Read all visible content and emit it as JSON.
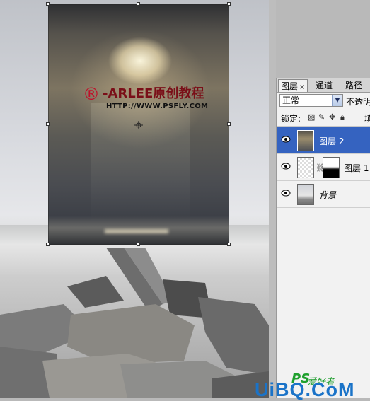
{
  "watermark": {
    "mark": "®",
    "title": "-ARLEE原创教程",
    "url": "HTTP://WWW.PSFLY.COM"
  },
  "layers_panel": {
    "tabs": [
      {
        "label": "图层",
        "close": "×",
        "active": true
      },
      {
        "label": "通道",
        "active": false
      },
      {
        "label": "路径",
        "active": false
      }
    ],
    "blend_mode": "正常",
    "opacity_label": "不透明",
    "lock_label": "锁定:",
    "fill_label": "填",
    "layers": [
      {
        "name": "图层 2",
        "selected": true,
        "visible": true
      },
      {
        "name": "图层 1",
        "selected": false,
        "visible": true,
        "has_mask": true
      },
      {
        "name": "背景",
        "selected": false,
        "visible": true,
        "italic": true
      }
    ]
  },
  "logo": {
    "ps": "PS",
    "cn": "爱好者",
    "site": "UiBQ.CoM"
  },
  "colors": {
    "selection": "#3563c0",
    "watermark_red": "#c0102a",
    "logo_blue": "#1a73c8",
    "logo_green": "#1fa02e"
  }
}
